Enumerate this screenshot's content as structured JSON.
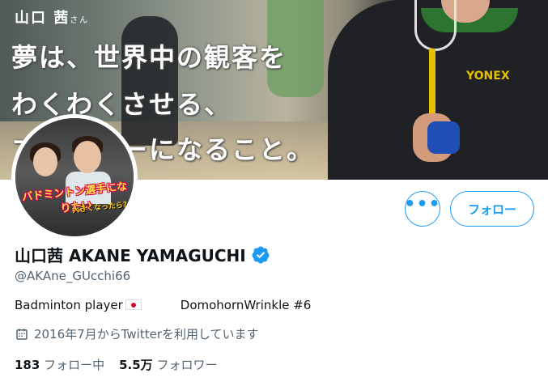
{
  "banner": {
    "name": "山口 茜",
    "name_suffix": "さん",
    "line1": "夢は、世界中の観客を",
    "line2": "わくわくさせる、",
    "line3": "プレーヤーになること。",
    "brand_logo": "YONEX"
  },
  "avatar": {
    "caption": "バドミントン選手になりたい",
    "subcaption": "大きくなったら?"
  },
  "actions": {
    "more_label": "•••",
    "follow_label": "フォロー"
  },
  "profile": {
    "display_name": "山口茜 AKANE YAMAGUCHI",
    "handle": "@AKAne_GUcchi66",
    "bio_part1": "Badminton player",
    "bio_part2": "DomohornWrinkle #6",
    "joined": "2016年7月からTwitterを利用しています",
    "following_count": "183",
    "following_label": "フォロー中",
    "followers_count": "5.5万",
    "followers_label": "フォロワー"
  },
  "colors": {
    "accent": "#1d9bf0",
    "text_primary": "#0f1419",
    "text_secondary": "#536471"
  },
  "icons": {
    "verified": "verified-badge-icon",
    "calendar": "calendar-icon",
    "flag": "japan-flag-icon"
  }
}
